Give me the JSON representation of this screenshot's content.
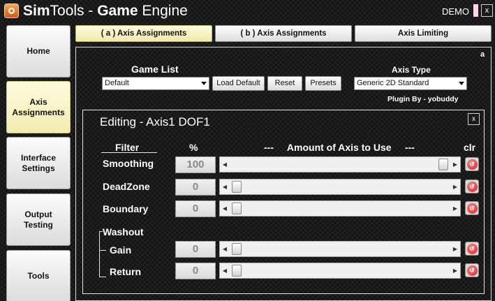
{
  "app": {
    "title_bold": "Sim",
    "title_mid": "Tools - ",
    "title_bold2": "Game",
    "title_end": " Engine",
    "mode": "DEMO",
    "close_label": "x"
  },
  "sidebar": {
    "items": [
      {
        "label": "Home"
      },
      {
        "label": "Axis\nAssignments",
        "active": true
      },
      {
        "label": "Interface\nSettings"
      },
      {
        "label": "Output\nTesting"
      },
      {
        "label": "Tools"
      }
    ]
  },
  "tabs": [
    {
      "label": "( a ) Axis Assignments",
      "active": true
    },
    {
      "label": "( b ) Axis Assignments"
    },
    {
      "label": "Axis Limiting"
    }
  ],
  "panel": {
    "letter": "a",
    "game_list_label": "Game List",
    "game_list_value": "Default",
    "load_default": "Load Default",
    "reset": "Reset",
    "presets": "Presets",
    "axis_type_label": "Axis Type",
    "axis_type_value": "Generic 2D Standard",
    "plugin_credit": "Plugin By - yobuddy"
  },
  "editor": {
    "title": "Editing - Axis1 DOF1",
    "close_label": "x",
    "headers": {
      "filter": "Filter",
      "percent": "%",
      "amount": "---     Amount of Axis to Use     ---",
      "clear": "clr"
    },
    "rows": [
      {
        "label": "Smoothing",
        "value": "100",
        "slider_fraction": 1.0
      },
      {
        "label": "DeadZone",
        "value": "0",
        "slider_fraction": 0.0
      },
      {
        "label": "Boundary",
        "value": "0",
        "slider_fraction": 0.0
      }
    ],
    "washout": {
      "label": "Washout",
      "rows": [
        {
          "label": "Gain",
          "value": "0",
          "slider_fraction": 0.0
        },
        {
          "label": "Return",
          "value": "0",
          "slider_fraction": 0.0
        }
      ]
    }
  },
  "colors": {
    "background": "#1b1b1b",
    "active_button": "#f2ecb0",
    "clear_button": "#d01a1a"
  }
}
